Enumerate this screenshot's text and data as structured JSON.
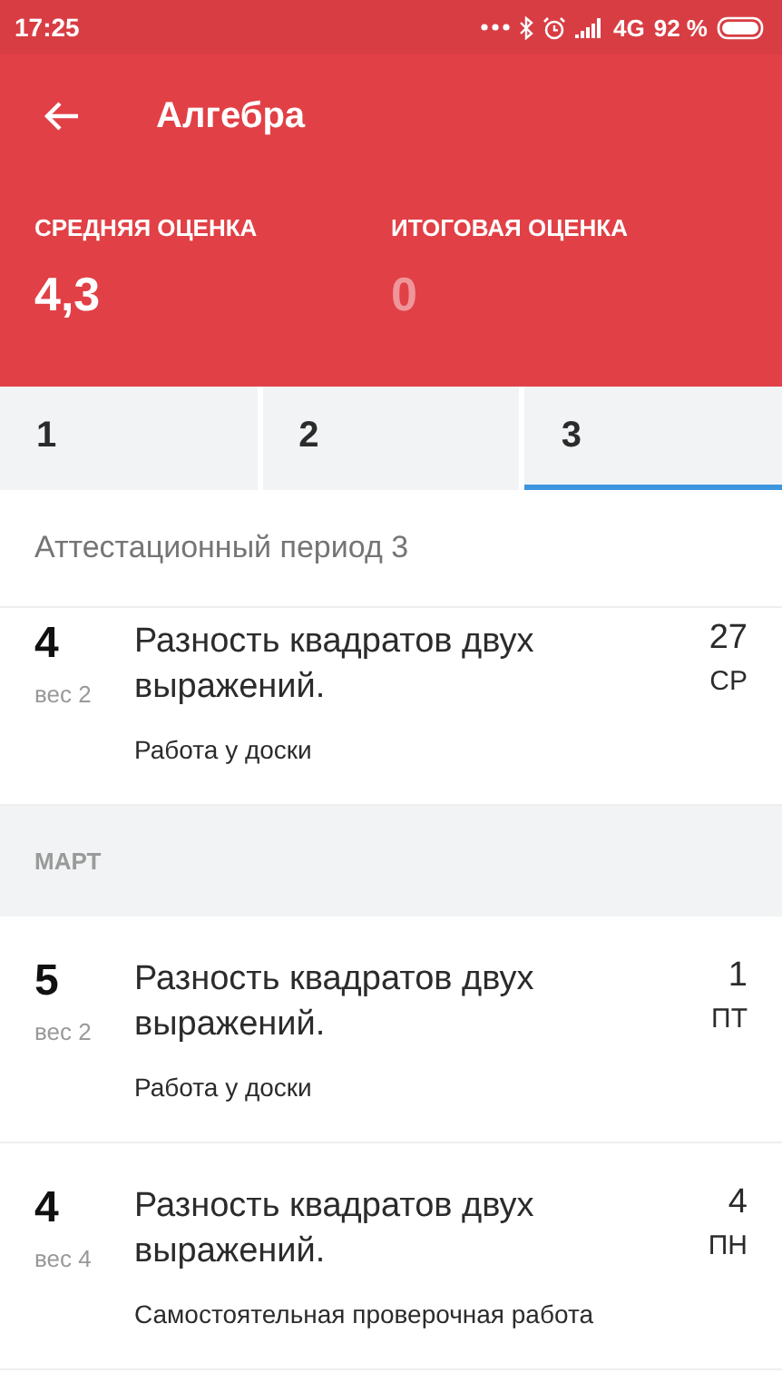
{
  "status_bar": {
    "time": "17:25",
    "network": "4G",
    "battery": "92 %"
  },
  "app_bar": {
    "title": "Алгебра"
  },
  "summary": [
    {
      "label": "СРЕДНЯЯ ОЦЕНКА",
      "value": "4,3",
      "dimmed": false
    },
    {
      "label": "ИТОГОВАЯ ОЦЕНКА",
      "value": "0",
      "dimmed": true
    }
  ],
  "tabs": [
    {
      "label": "1",
      "selected": false
    },
    {
      "label": "2",
      "selected": false
    },
    {
      "label": "3",
      "selected": true
    }
  ],
  "period_title": "Аттестационный период 3",
  "entries": [
    {
      "kind": "grade",
      "grade": "4",
      "weight": "вес 2",
      "topic": "Разность квадратов двух выражений.",
      "work": "Работа у доски",
      "day": "27",
      "weekday": "СР",
      "clipped": true
    },
    {
      "kind": "month",
      "label": "МАРТ"
    },
    {
      "kind": "grade",
      "grade": "5",
      "weight": "вес 2",
      "topic": "Разность квадратов двух выражений.",
      "work": "Работа у доски",
      "day": "1",
      "weekday": "ПТ",
      "clipped": false
    },
    {
      "kind": "grade",
      "grade": "4",
      "weight": "вес 4",
      "topic": "Разность квадратов двух выражений.",
      "work": "Самостоятельная проверочная работа",
      "day": "4",
      "weekday": "ПН",
      "clipped": false
    }
  ]
}
